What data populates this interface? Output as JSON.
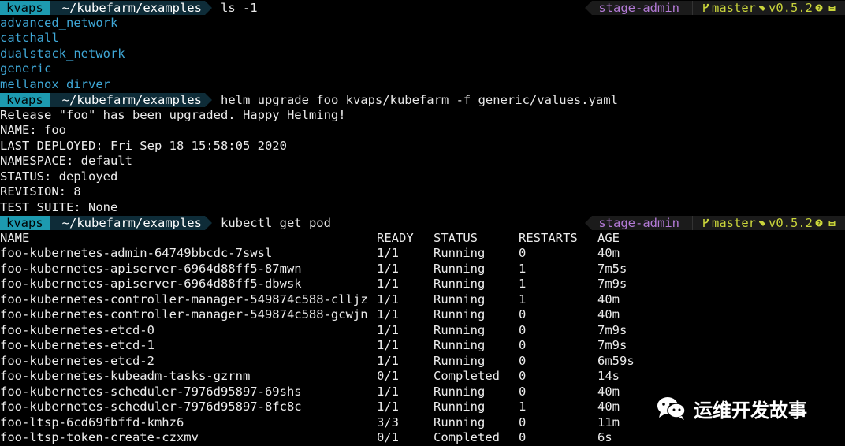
{
  "colors": {
    "user_segment_bg": "#1d9ab0",
    "dir_segment_bg": "#0e2c38",
    "context_text": "#b37ad6",
    "git_text": "#c9d43b",
    "ls_output_text": "#3fa7d6"
  },
  "prompt": {
    "user": "kvaps",
    "cwd": "~/kubefarm/examples",
    "context": "stage-admin",
    "branch_icon": "git-branch-icon",
    "branch": "master",
    "tag_icon": "tag-icon",
    "tag": "v0.5.2",
    "status_icons": [
      "question-icon",
      "cat-icon"
    ]
  },
  "blocks": [
    {
      "command": "ls -1",
      "show_right_prompt": true,
      "output": [
        "advanced_network",
        "catchall",
        "dualstack_network",
        "generic",
        "mellanox_dirver"
      ]
    },
    {
      "command": "helm upgrade foo kvaps/kubefarm -f generic/values.yaml",
      "show_right_prompt": false,
      "output": [
        "Release \"foo\" has been upgraded. Happy Helming!",
        "NAME: foo",
        "LAST DEPLOYED: Fri Sep 18 15:58:05 2020",
        "NAMESPACE: default",
        "STATUS: deployed",
        "REVISION: 8",
        "TEST SUITE: None"
      ]
    },
    {
      "command": "kubectl get pod",
      "show_right_prompt": true
    }
  ],
  "pods": {
    "headers": [
      "NAME",
      "READY",
      "STATUS",
      "RESTARTS",
      "AGE"
    ],
    "rows": [
      [
        "foo-kubernetes-admin-64749bbcdc-7swsl",
        "1/1",
        "Running",
        "0",
        "40m"
      ],
      [
        "foo-kubernetes-apiserver-6964d88ff5-87mwn",
        "1/1",
        "Running",
        "1",
        "7m5s"
      ],
      [
        "foo-kubernetes-apiserver-6964d88ff5-dbwsk",
        "1/1",
        "Running",
        "1",
        "7m9s"
      ],
      [
        "foo-kubernetes-controller-manager-549874c588-clljz",
        "1/1",
        "Running",
        "1",
        "40m"
      ],
      [
        "foo-kubernetes-controller-manager-549874c588-gcwjn",
        "1/1",
        "Running",
        "0",
        "40m"
      ],
      [
        "foo-kubernetes-etcd-0",
        "1/1",
        "Running",
        "0",
        "7m9s"
      ],
      [
        "foo-kubernetes-etcd-1",
        "1/1",
        "Running",
        "0",
        "7m9s"
      ],
      [
        "foo-kubernetes-etcd-2",
        "1/1",
        "Running",
        "0",
        "6m59s"
      ],
      [
        "foo-kubernetes-kubeadm-tasks-gzrnm",
        "0/1",
        "Completed",
        "0",
        "14s"
      ],
      [
        "foo-kubernetes-scheduler-7976d95897-69shs",
        "1/1",
        "Running",
        "0",
        "40m"
      ],
      [
        "foo-kubernetes-scheduler-7976d95897-8fc8c",
        "1/1",
        "Running",
        "1",
        "40m"
      ],
      [
        "foo-ltsp-6cd69fbffd-kmhz6",
        "3/3",
        "Running",
        "0",
        "11m"
      ],
      [
        "foo-ltsp-token-create-czxmv",
        "0/1",
        "Completed",
        "0",
        "6s"
      ]
    ]
  },
  "watermark": {
    "icon": "wechat-icon",
    "text": "运维开发故事"
  }
}
